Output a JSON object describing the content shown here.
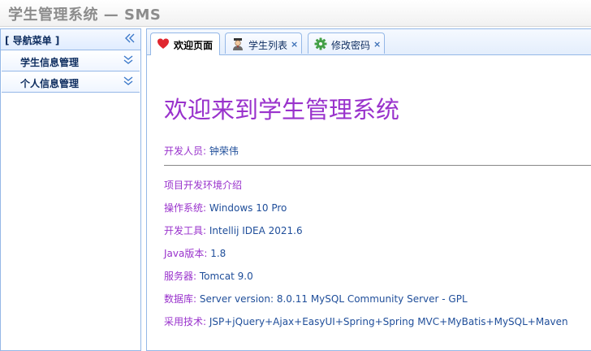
{
  "app": {
    "title": "学生管理系统 — SMS"
  },
  "sidebar": {
    "title": "[ 导航菜单 ]",
    "items": [
      {
        "label": "学生信息管理"
      },
      {
        "label": "个人信息管理"
      }
    ]
  },
  "tabs": [
    {
      "label": "欢迎页面",
      "icon": "heart-icon",
      "closable": false,
      "active": true
    },
    {
      "label": "学生列表",
      "icon": "student-icon",
      "closable": true,
      "active": false
    },
    {
      "label": "修改密码",
      "icon": "gear-icon",
      "closable": true,
      "active": false
    }
  ],
  "tab_close_glyph": "×",
  "welcome": {
    "title": "欢迎来到学生管理系统",
    "developer_label": "开发人员: ",
    "developer_value": "钟荣伟",
    "env_intro": "项目开发环境介绍",
    "env": [
      {
        "label": "操作系统: ",
        "value": "Windows 10 Pro"
      },
      {
        "label": "开发工具: ",
        "value": "Intellij IDEA 2021.6"
      },
      {
        "label": "Java版本: ",
        "value": "1.8"
      },
      {
        "label": "服务器: ",
        "value": "Tomcat 9.0"
      },
      {
        "label": "数据库: ",
        "value": "Server version: 8.0.11 MySQL Community Server - GPL"
      },
      {
        "label": "采用技术: ",
        "value": "JSP+jQuery+Ajax+EasyUI+Spring+Spring MVC+MyBatis+MySQL+Maven"
      }
    ]
  },
  "colors": {
    "accent": "#9932cc",
    "value_text": "#1f4e9a",
    "border": "#95b8e7",
    "heart": "#e0262f",
    "gear": "#43a047"
  }
}
